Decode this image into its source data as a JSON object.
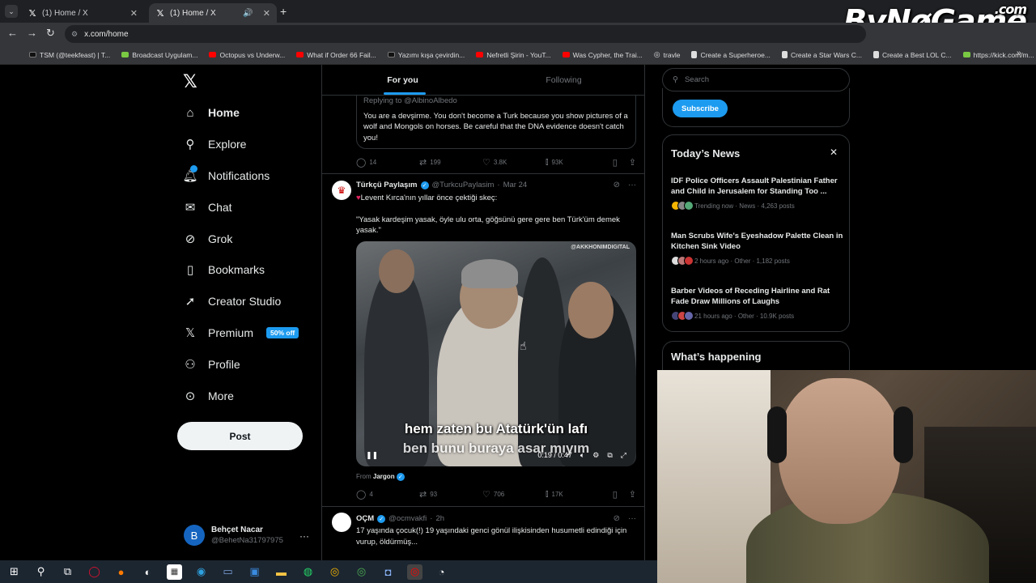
{
  "browser": {
    "tabs": [
      {
        "title": "(1) Home / X",
        "active": false
      },
      {
        "title": "(1) Home / X",
        "active": true
      }
    ],
    "url": "x.com/home",
    "bookmarks": [
      {
        "label": "TSM (@teekfeast) | T...",
        "icon": "tiktok"
      },
      {
        "label": "Broadcast Uygulam...",
        "icon": "nvidia"
      },
      {
        "label": "Octopus vs Underw...",
        "icon": "youtube"
      },
      {
        "label": "What if Order 66 Fail...",
        "icon": "youtube"
      },
      {
        "label": "Yazımı kışa çevirdin...",
        "icon": "tiktok"
      },
      {
        "label": "Nefretli Şirin - YouT...",
        "icon": "youtube"
      },
      {
        "label": "Was Cypher, the Trai...",
        "icon": "youtube"
      },
      {
        "label": "travle",
        "icon": "globe"
      },
      {
        "label": "Create a Superheroe...",
        "icon": "doc"
      },
      {
        "label": "Create a Star Wars C...",
        "icon": "doc"
      },
      {
        "label": "Create a Best LOL C...",
        "icon": "doc"
      },
      {
        "label": "https://kick.com/m...",
        "icon": "kick"
      }
    ]
  },
  "watermark": {
    "main": "ByNøGame",
    "suffix": ".com"
  },
  "nav": {
    "items": [
      {
        "label": "Home",
        "icon": "home-icon"
      },
      {
        "label": "Explore",
        "icon": "search-icon"
      },
      {
        "label": "Notifications",
        "icon": "bell-icon"
      },
      {
        "label": "Chat",
        "icon": "mail-icon"
      },
      {
        "label": "Grok",
        "icon": "grok-icon"
      },
      {
        "label": "Bookmarks",
        "icon": "bookmark-icon"
      },
      {
        "label": "Creator Studio",
        "icon": "rocket-icon"
      },
      {
        "label": "Premium",
        "icon": "x-icon"
      },
      {
        "label": "Profile",
        "icon": "person-icon"
      },
      {
        "label": "More",
        "icon": "more-circle-icon"
      }
    ],
    "premium_badge": "50% off",
    "post_label": "Post",
    "account": {
      "initial": "B",
      "name": "Behçet Nacar",
      "handle": "@BehetNa31797975"
    }
  },
  "feed": {
    "tabs": [
      "For you",
      "Following"
    ],
    "quote": {
      "replying": "Replying to @AlbinoAlbedo",
      "text": "You are a devşirme. You don't become a Turk because you show pictures of a wolf and Mongols on horses. Be careful that the DNA evidence doesn't catch you!"
    },
    "quote_stats": {
      "replies": "14",
      "reposts": "199",
      "likes": "3.8K",
      "views": "93K"
    },
    "tweet": {
      "name": "Türkçü Paylaşım",
      "handle": "@TurkcuPaylasim",
      "date": "Mar 24",
      "line1": "Levent Kırca'nın yıllar önce çektiği skeç:",
      "line2": "\"Yasak kardeşim yasak, öyle ulu orta, göğsünü gere gere ben Türk'üm demek yasak.\"",
      "video_watermark": "@AKKHONIMDIGITAL",
      "subtitle1": "hem zaten bu Atatürk'ün lafı",
      "subtitle2": "ben bunu buraya asar mıyım",
      "time": "0:19 / 0:47",
      "from_label": "From",
      "from_name": "Jargon",
      "stats": {
        "replies": "4",
        "reposts": "93",
        "likes": "706",
        "views": "17K"
      }
    },
    "tweet2": {
      "name": "OÇM",
      "handle": "@ocmvakfi",
      "date": "2h",
      "text": "17 yaşında çocuk(!) 19 yaşındaki genci gönül ilişkisinden husumetli edindiği için vurup, öldürmüş..."
    }
  },
  "right": {
    "search_placeholder": "Search",
    "subscribe_label": "Subscribe",
    "news_title": "Today’s News",
    "news": [
      {
        "headline": "IDF Police Officers Assault Palestinian Father and Child in Jerusalem for Standing Too ...",
        "meta": "Trending now · News · 4,263 posts"
      },
      {
        "headline": "Man Scrubs Wife's Eyeshadow Palette Clean in Kitchen Sink Video",
        "meta": "2 hours ago · Other · 1,182 posts"
      },
      {
        "headline": "Barber Videos of Receding Hairline and Rat Fade Draw Millions of Laughs",
        "meta": "21 hours ago · Other · 10.9K posts"
      }
    ],
    "happening_title": "What’s happening"
  },
  "colors": {
    "accent": "#1d9bf0",
    "background": "#000000",
    "border": "#2f3336",
    "muted": "#71767b"
  }
}
